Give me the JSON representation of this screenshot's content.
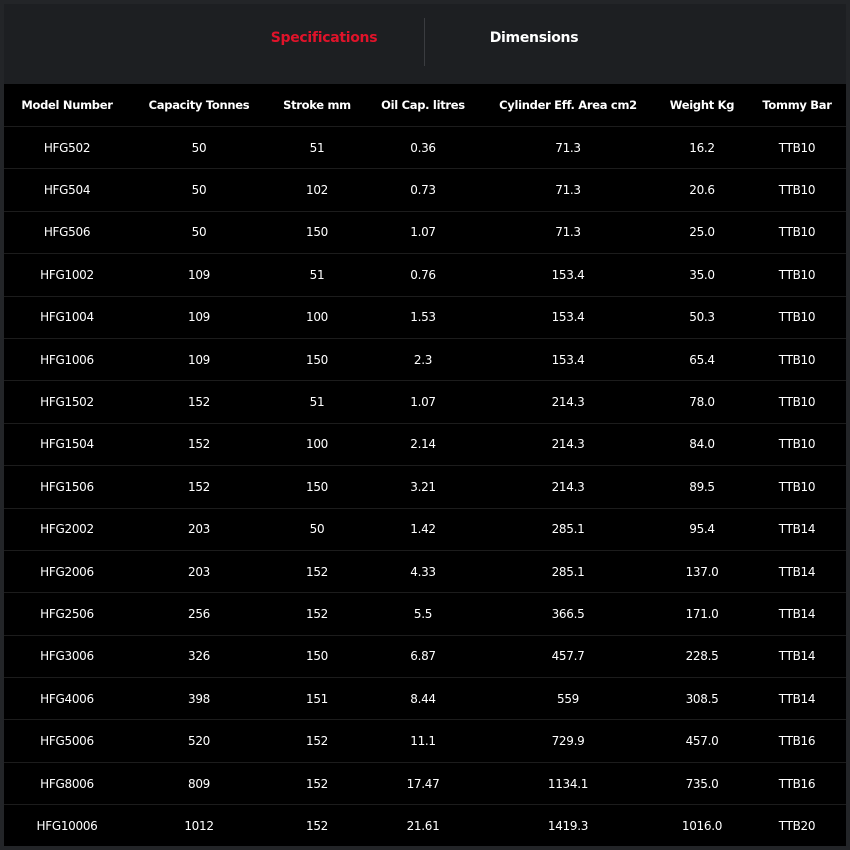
{
  "theme": {
    "accent": "#e0132a"
  },
  "tabs": {
    "specifications": "Specifications",
    "dimensions": "Dimensions"
  },
  "table": {
    "headers": [
      "Model Number",
      "Capacity Tonnes",
      "Stroke mm",
      "Oil Cap. litres",
      "Cylinder Eff. Area cm2",
      "Weight Kg",
      "Tommy Bar"
    ],
    "rows": [
      [
        "HFG502",
        "50",
        "51",
        "0.36",
        "71.3",
        "16.2",
        "TTB10"
      ],
      [
        "HFG504",
        "50",
        "102",
        "0.73",
        "71.3",
        "20.6",
        "TTB10"
      ],
      [
        "HFG506",
        "50",
        "150",
        "1.07",
        "71.3",
        "25.0",
        "TTB10"
      ],
      [
        "HFG1002",
        "109",
        "51",
        "0.76",
        "153.4",
        "35.0",
        "TTB10"
      ],
      [
        "HFG1004",
        "109",
        "100",
        "1.53",
        "153.4",
        "50.3",
        "TTB10"
      ],
      [
        "HFG1006",
        "109",
        "150",
        "2.3",
        "153.4",
        "65.4",
        "TTB10"
      ],
      [
        "HFG1502",
        "152",
        "51",
        "1.07",
        "214.3",
        "78.0",
        "TTB10"
      ],
      [
        "HFG1504",
        "152",
        "100",
        "2.14",
        "214.3",
        "84.0",
        "TTB10"
      ],
      [
        "HFG1506",
        "152",
        "150",
        "3.21",
        "214.3",
        "89.5",
        "TTB10"
      ],
      [
        "HFG2002",
        "203",
        "50",
        "1.42",
        "285.1",
        "95.4",
        "TTB14"
      ],
      [
        "HFG2006",
        "203",
        "152",
        "4.33",
        "285.1",
        "137.0",
        "TTB14"
      ],
      [
        "HFG2506",
        "256",
        "152",
        "5.5",
        "366.5",
        "171.0",
        "TTB14"
      ],
      [
        "HFG3006",
        "326",
        "150",
        "6.87",
        "457.7",
        "228.5",
        "TTB14"
      ],
      [
        "HFG4006",
        "398",
        "151",
        "8.44",
        "559",
        "308.5",
        "TTB14"
      ],
      [
        "HFG5006",
        "520",
        "152",
        "11.1",
        "729.9",
        "457.0",
        "TTB16"
      ],
      [
        "HFG8006",
        "809",
        "152",
        "17.47",
        "1134.1",
        "735.0",
        "TTB16"
      ],
      [
        "HFG10006",
        "1012",
        "152",
        "21.61",
        "1419.3",
        "1016.0",
        "TTB20"
      ]
    ]
  }
}
